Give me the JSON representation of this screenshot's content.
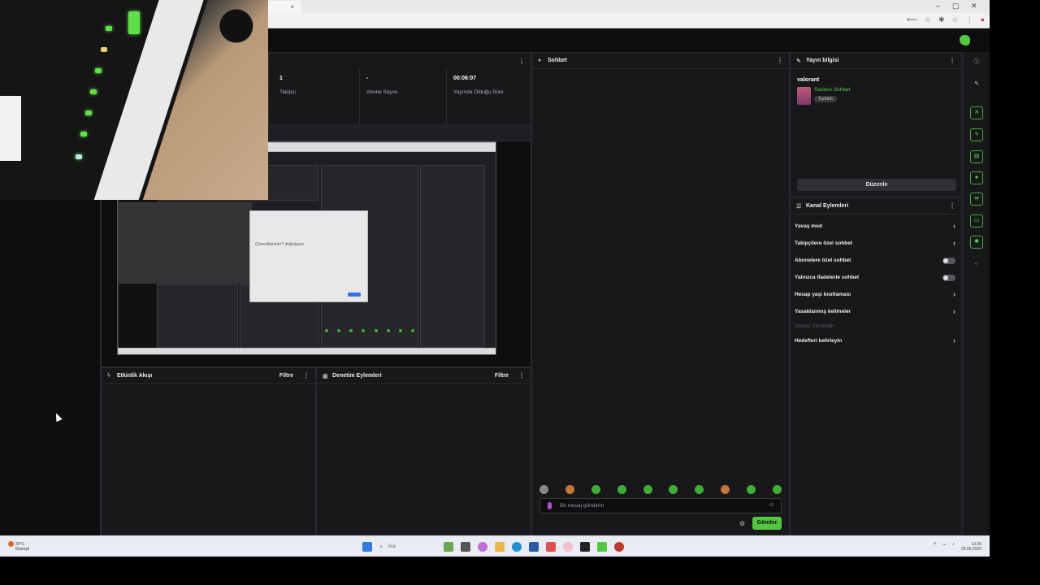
{
  "browser": {
    "tab_close": "×",
    "win_controls": [
      "–",
      "▢",
      "✕"
    ],
    "addr_icons": [
      "⟵",
      "☆",
      "✱",
      "☆",
      "⋮",
      "●"
    ]
  },
  "stats": [
    {
      "value": "1",
      "label": "Takipçi"
    },
    {
      "value": "-",
      "label": "Abone Sayısı"
    },
    {
      "value": "00:06:07",
      "label": "Yayında Olduğu Süre"
    }
  ],
  "chat": {
    "title": "Sohbet",
    "input_placeholder": "Bir mesaj gönderin",
    "send_label": "Gönder",
    "settings_icon": "⚙"
  },
  "activity": {
    "title": "Etkinlik Akışı",
    "filter": "Filtre"
  },
  "moderation": {
    "title": "Denetim Eylemleri",
    "filter": "Filtre"
  },
  "stream_info": {
    "header": "Yayın bilgisi",
    "title": "valorant",
    "category": "Sadece Sohbet",
    "tag": "Turkish",
    "edit_label": "Düzenle"
  },
  "channel_actions": {
    "header": "Kanal Eylemleri",
    "items": [
      {
        "label": "Yavaş mod",
        "control": "chevron"
      },
      {
        "label": "Takipçilere özel sohbet",
        "control": "chevron"
      },
      {
        "label": "Abonelere özel sohbet",
        "control": "toggle"
      },
      {
        "label": "Yalnızca ifadelerle sohbet",
        "control": "toggle"
      },
      {
        "label": "Hesap yaşı kısıtlaması",
        "control": "chevron"
      },
      {
        "label": "Yasaklanmış kelimeler",
        "control": "chevron"
      },
      {
        "label": "İzleyici Yönlendir",
        "control": "none",
        "disabled": true
      },
      {
        "label": "Hedefleri belirleyin",
        "control": "chevron"
      }
    ]
  },
  "preview_dialog_title": "Güncellemeler? doğrulayın",
  "taskbar": {
    "weather_temp": "20°C",
    "weather_text": "Güneşli",
    "search": "Ara",
    "time": "13:35",
    "date": "06.06.2025"
  },
  "colors": {
    "accent": "#53c741",
    "bg": "#18181b",
    "panel_border": "#2b2b2f"
  }
}
